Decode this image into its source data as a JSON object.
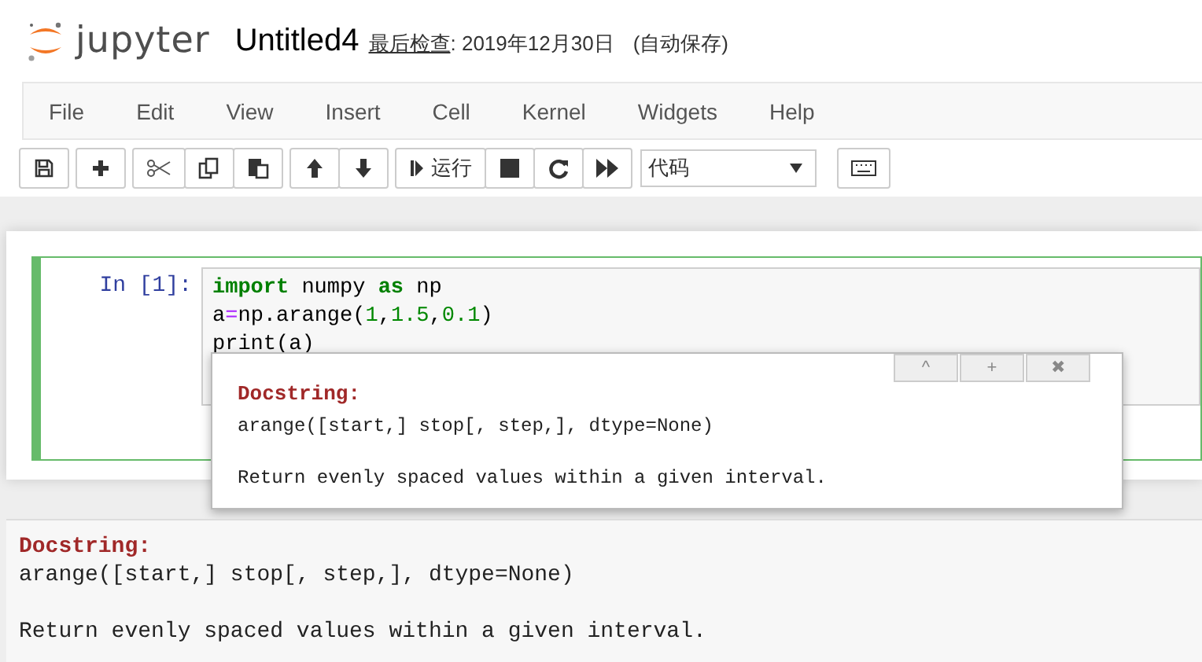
{
  "header": {
    "logo": "jupyter",
    "notebook_name": "Untitled4",
    "checkpoint_label": "最后检查",
    "checkpoint_time": ": 2019年12月30日",
    "autosave": "(自动保存)"
  },
  "menu": [
    "File",
    "Edit",
    "View",
    "Insert",
    "Cell",
    "Kernel",
    "Widgets",
    "Help"
  ],
  "toolbar": {
    "groups": [
      [
        {
          "kind": "save"
        }
      ],
      [
        {
          "kind": "add"
        }
      ],
      [
        {
          "kind": "cut"
        },
        {
          "kind": "copy"
        },
        {
          "kind": "paste"
        }
      ],
      [
        {
          "kind": "up"
        },
        {
          "kind": "down"
        }
      ],
      [
        {
          "kind": "run",
          "label": "运行"
        },
        {
          "kind": "stop"
        },
        {
          "kind": "restart"
        },
        {
          "kind": "fastforward"
        }
      ]
    ],
    "cell_type": "代码"
  },
  "cell": {
    "prompt": "In [1]:",
    "selected": true,
    "lines": [
      [
        {
          "kind": "keyword",
          "text": "import"
        },
        {
          "kind": "plain",
          "text": " numpy "
        },
        {
          "kind": "keyword",
          "text": "as"
        },
        {
          "kind": "plain",
          "text": " np"
        }
      ],
      [
        {
          "kind": "plain",
          "text": "a"
        },
        {
          "kind": "operator",
          "text": "="
        },
        {
          "kind": "plain",
          "text": "np.arange("
        },
        {
          "kind": "number",
          "text": "1"
        },
        {
          "kind": "plain",
          "text": ","
        },
        {
          "kind": "number",
          "text": "1.5"
        },
        {
          "kind": "plain",
          "text": ","
        },
        {
          "kind": "number",
          "text": "0.1"
        },
        {
          "kind": "plain",
          "text": ")"
        }
      ],
      [
        {
          "kind": "plain",
          "text": "print(a)"
        }
      ]
    ]
  },
  "tooltip": {
    "heading": "Docstring:",
    "signature": "arange([start,] stop[, step,], dtype=None)",
    "description": "Return evenly spaced values within a given interval.",
    "buttons": [
      "^",
      "+",
      "✖"
    ]
  },
  "pager": {
    "heading": "Docstring:",
    "signature": "arange([start,] stop[, step,], dtype=None)",
    "description": "Return evenly spaced values within a given interval."
  }
}
